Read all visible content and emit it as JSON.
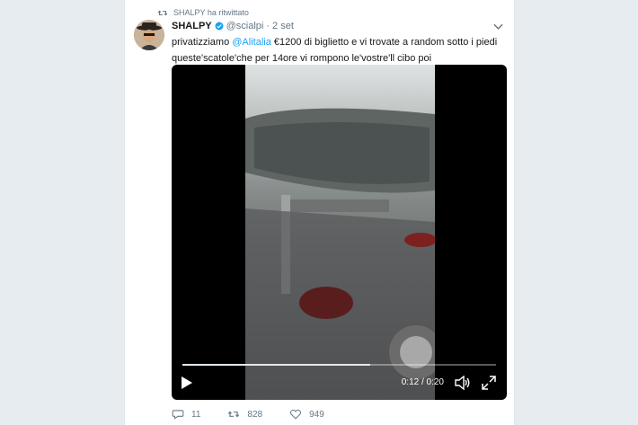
{
  "tweet": {
    "retweet_context": "SHALPY ha ritwittato",
    "author_name": "SHALPY",
    "author_handle": "@scialpi",
    "separator": "·",
    "timestamp": "2 set",
    "text_part1": "privatizziamo ",
    "mention": "@Alitalia",
    "text_part2": " €1200 di biglietto e vi trovate a random sotto i piedi queste'scatole'che per 14ore vi rompono le'vostre'll cibo poi"
  },
  "video": {
    "timecode": "0:12 / 0:20",
    "progress": 0.6
  },
  "actions": {
    "reply_count": "11",
    "retweet_count": "828",
    "like_count": "949"
  },
  "colors": {
    "accent": "#1da1f2",
    "secondary_text": "#657786",
    "background": "#e6ecf0"
  },
  "icons": [
    "retweet-icon",
    "verified-icon",
    "chevron-down-icon",
    "play-icon",
    "volume-icon",
    "fullscreen-icon",
    "reply-icon",
    "like-icon"
  ]
}
